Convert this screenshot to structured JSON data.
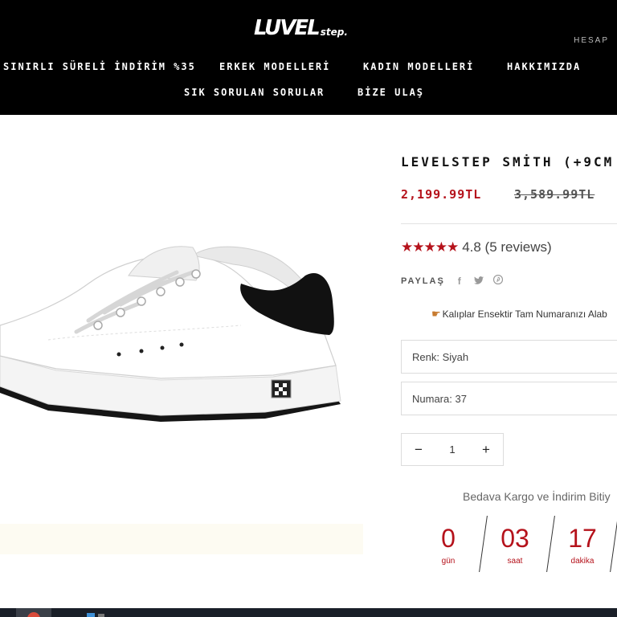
{
  "header": {
    "logo_mark": "LUVEL",
    "logo_sub": "step.",
    "account": "HESAP",
    "nav": [
      {
        "label": "SINIRLI SÜRELİ İNDİRİM %35"
      },
      {
        "label": "ERKEK MODELLERİ"
      },
      {
        "label": "KADIN MODELLERİ"
      },
      {
        "label": "HAKKIMIZDA"
      },
      {
        "label": "SIK SORULAN SORULAR"
      },
      {
        "label": "BİZE ULAŞ"
      }
    ]
  },
  "product": {
    "title": "LEVELSTEP SMİTH (+9CM",
    "price_sale": "2,199.99TL",
    "price_old": "3,589.99TL",
    "stars": "★★★★★",
    "rating_text": "4.8 (5 reviews)",
    "share_label": "PAYLAŞ",
    "share_icons": [
      "facebook-icon",
      "twitter-icon",
      "pinterest-icon"
    ],
    "note": "Kalıplar Ensektir Tam Numaranızı Alab",
    "color_select": "Renk: Siyah",
    "size_select": "Numara: 37",
    "quantity": "1"
  },
  "promo": {
    "text": "Bedava Kargo ve İndirim Bitiy",
    "countdown": [
      {
        "value": "0",
        "label": "gün"
      },
      {
        "value": "03",
        "label": "saat"
      },
      {
        "value": "17",
        "label": "dakika"
      }
    ]
  },
  "colors": {
    "accent": "#b5121b",
    "header_bg": "#000000"
  }
}
